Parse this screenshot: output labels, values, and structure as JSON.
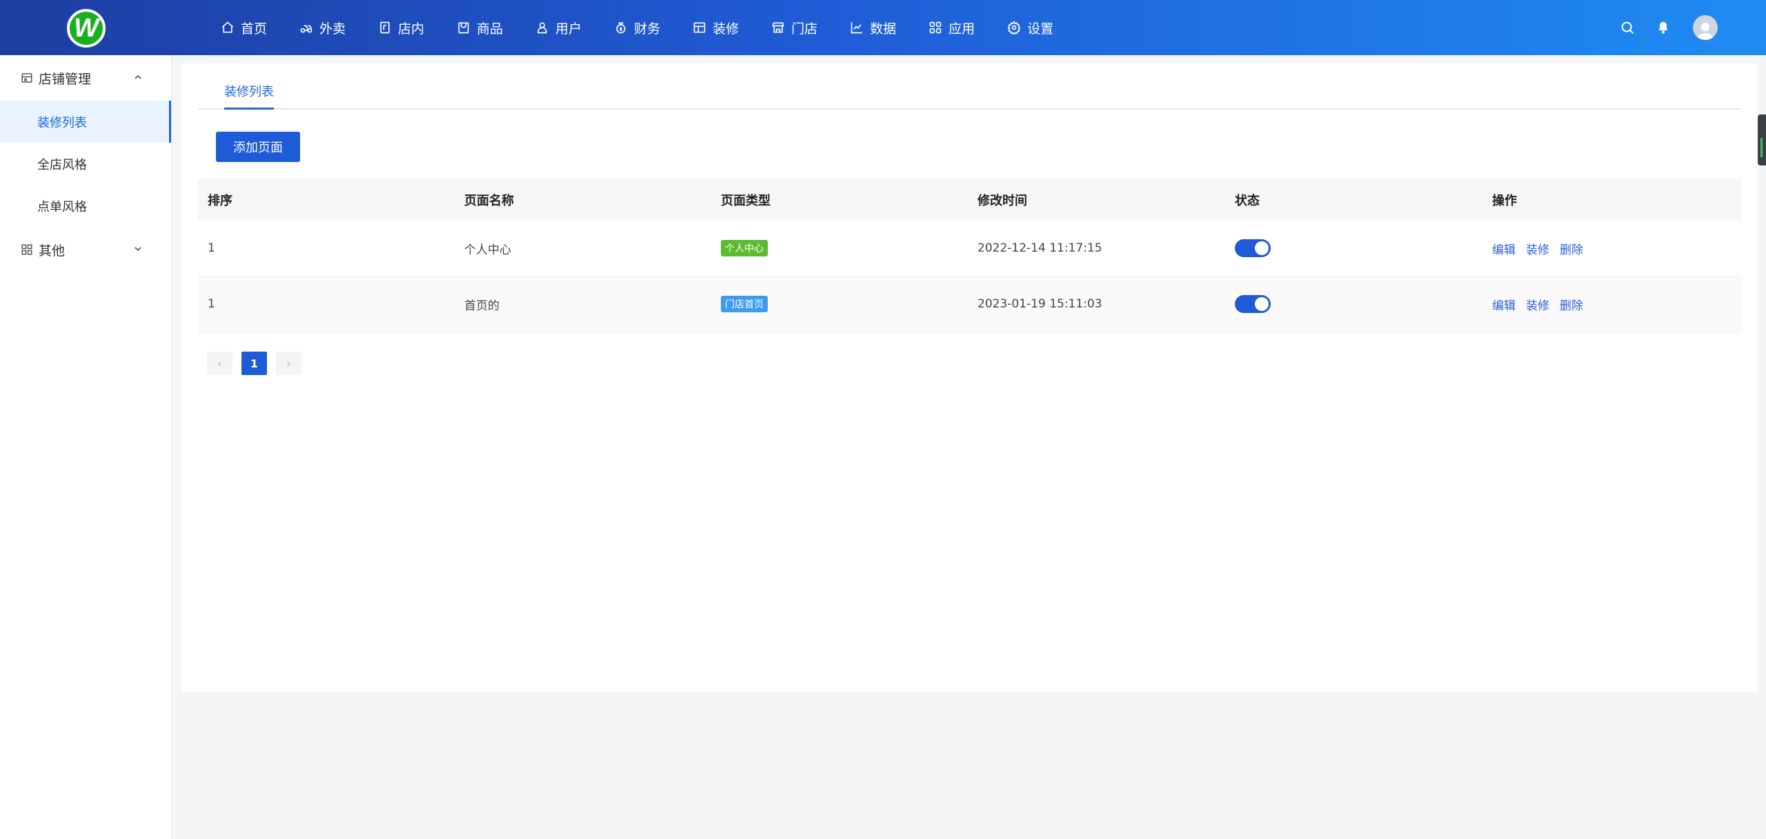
{
  "brand": {
    "logo_letter": "W",
    "logo_color": "#19b01f"
  },
  "nav": [
    {
      "label": "首页",
      "icon": "home-icon"
    },
    {
      "label": "外卖",
      "icon": "delivery-icon"
    },
    {
      "label": "店内",
      "icon": "dine-in-icon"
    },
    {
      "label": "商品",
      "icon": "goods-icon"
    },
    {
      "label": "用户",
      "icon": "user-icon"
    },
    {
      "label": "财务",
      "icon": "finance-icon"
    },
    {
      "label": "装修",
      "icon": "decorate-icon"
    },
    {
      "label": "门店",
      "icon": "store-icon"
    },
    {
      "label": "数据",
      "icon": "chart-icon"
    },
    {
      "label": "应用",
      "icon": "apps-icon"
    },
    {
      "label": "设置",
      "icon": "gear-icon"
    }
  ],
  "sidebar": {
    "group1": {
      "label": "店铺管理",
      "icon": "shop-manage-icon",
      "expanded": true
    },
    "items": [
      {
        "label": "装修列表",
        "active": true
      },
      {
        "label": "全店风格",
        "active": false
      },
      {
        "label": "点单风格",
        "active": false
      }
    ],
    "group2": {
      "label": "其他",
      "icon": "grid-icon",
      "expanded": false
    }
  },
  "tabs": [
    {
      "label": "装修列表"
    }
  ],
  "toolbar": {
    "add_label": "添加页面"
  },
  "table": {
    "headers": [
      "排序",
      "页面名称",
      "页面类型",
      "修改时间",
      "状态",
      "操作"
    ],
    "rows": [
      {
        "sort": "1",
        "name": "个人中心",
        "type": "个人中心",
        "type_color": "#5dbb2f",
        "time": "2022-12-14 11:17:15",
        "status": true
      },
      {
        "sort": "1",
        "name": "首页的",
        "type": "门店首页",
        "type_color": "#3d9bf0",
        "time": "2023-01-19 15:11:03",
        "status": true
      }
    ],
    "actions": {
      "edit": "编辑",
      "decorate": "装修",
      "delete": "删除"
    }
  },
  "pagination": {
    "prev": "‹",
    "current": "1",
    "next": "›"
  },
  "colors": {
    "primary": "#1e5bd6",
    "header_start": "#1d3ea0",
    "header_end": "#1f8cf2"
  }
}
